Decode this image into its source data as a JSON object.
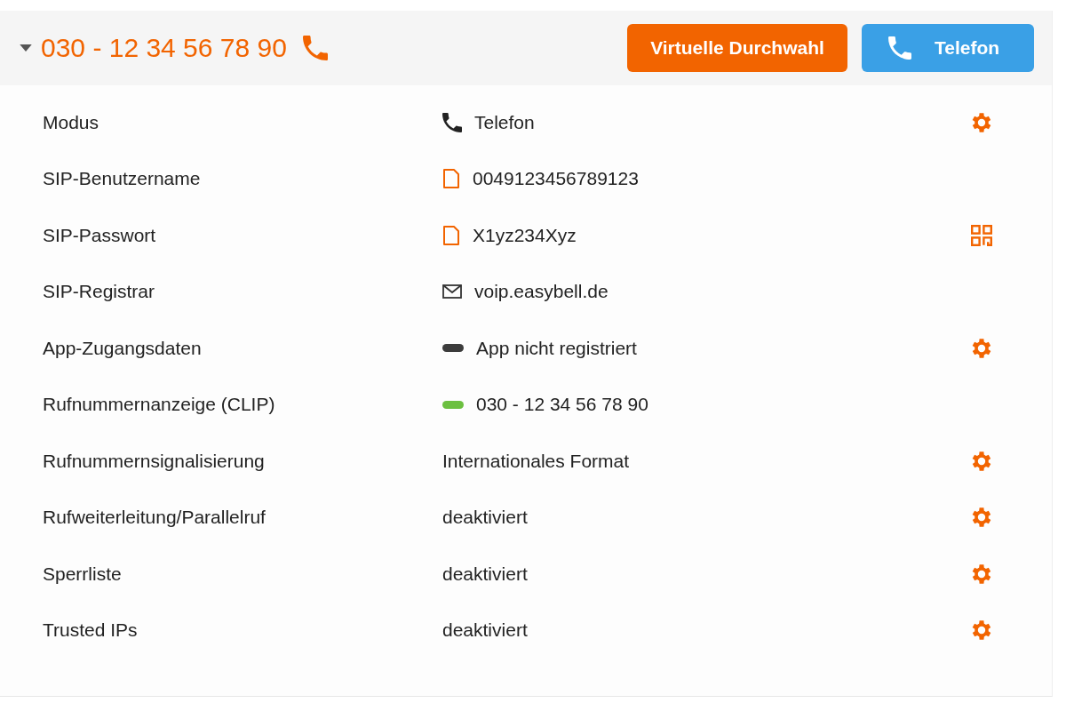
{
  "header": {
    "expanded": true,
    "number": "030 - 12 34 56 78 90",
    "buttons": [
      {
        "label": "Virtuelle Durchwahl",
        "kind": "orange"
      },
      {
        "label": "Telefon",
        "kind": "blue"
      }
    ]
  },
  "rows": [
    {
      "label": "Modus",
      "value": "Telefon",
      "kind": "phone",
      "action": {
        "kind": "settings"
      }
    },
    {
      "label": "SIP-Benutzername",
      "value": "0049123456789123",
      "kind": "copy"
    },
    {
      "label": "SIP-Passwort",
      "value": "X1yz234Xyz",
      "kind": "copy",
      "action": {
        "kind": "qr"
      }
    },
    {
      "label": "SIP-Registrar",
      "value": "voip.easybell.de",
      "kind": "mail"
    },
    {
      "label": "App-Zugangsdaten",
      "value": "App nicht registriert",
      "kind": "status",
      "color": "#3c3c3c",
      "action": {
        "kind": "settings"
      }
    },
    {
      "label": "Rufnummernanzeige (CLIP)",
      "value": "030 - 12 34 56 78 90",
      "kind": "status",
      "color": "#6cc040"
    },
    {
      "label": "Rufnummernsignalisierung",
      "value": "Internationales Format",
      "action": {
        "kind": "settings"
      }
    },
    {
      "label": "Rufweiterleitung/Parallelruf",
      "value": "deaktiviert",
      "action": {
        "kind": "settings"
      }
    },
    {
      "label": "Sperrliste",
      "value": "deaktiviert",
      "action": {
        "kind": "settings"
      }
    },
    {
      "label": "Trusted IPs",
      "value": "deaktiviert",
      "action": {
        "kind": "settings"
      }
    }
  ]
}
